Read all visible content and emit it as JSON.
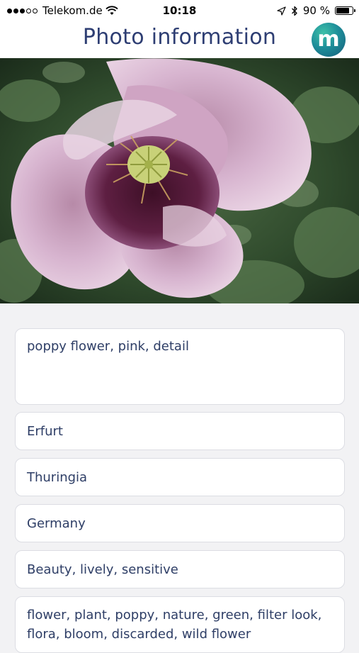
{
  "status_bar": {
    "carrier": "Telekom.de",
    "time": "10:18",
    "battery": "90 %",
    "battery_level": 0.9,
    "signal_bars": 3,
    "signal_total": 5,
    "icons": [
      "wifi-icon",
      "location-arrow-icon",
      "bluetooth-icon",
      "battery-icon"
    ]
  },
  "header": {
    "title": "Photo information",
    "logo_letter": "m",
    "logo_colors": [
      "#3ec0a8",
      "#165c7a"
    ]
  },
  "photo": {
    "subject": "poppy flower image"
  },
  "fields": {
    "description": "poppy flower, pink, detail",
    "city": "Erfurt",
    "state": "Thuringia",
    "country": "Germany",
    "mood": "Beauty, lively, sensitive",
    "keywords": "flower, plant, poppy, nature, green, filter look, flora, bloom, discarded, wild flower"
  },
  "colors": {
    "title_text": "#2e3e73",
    "field_text": "#2e3e66",
    "field_border": "#dcdde3",
    "background": "#f2f2f4"
  }
}
